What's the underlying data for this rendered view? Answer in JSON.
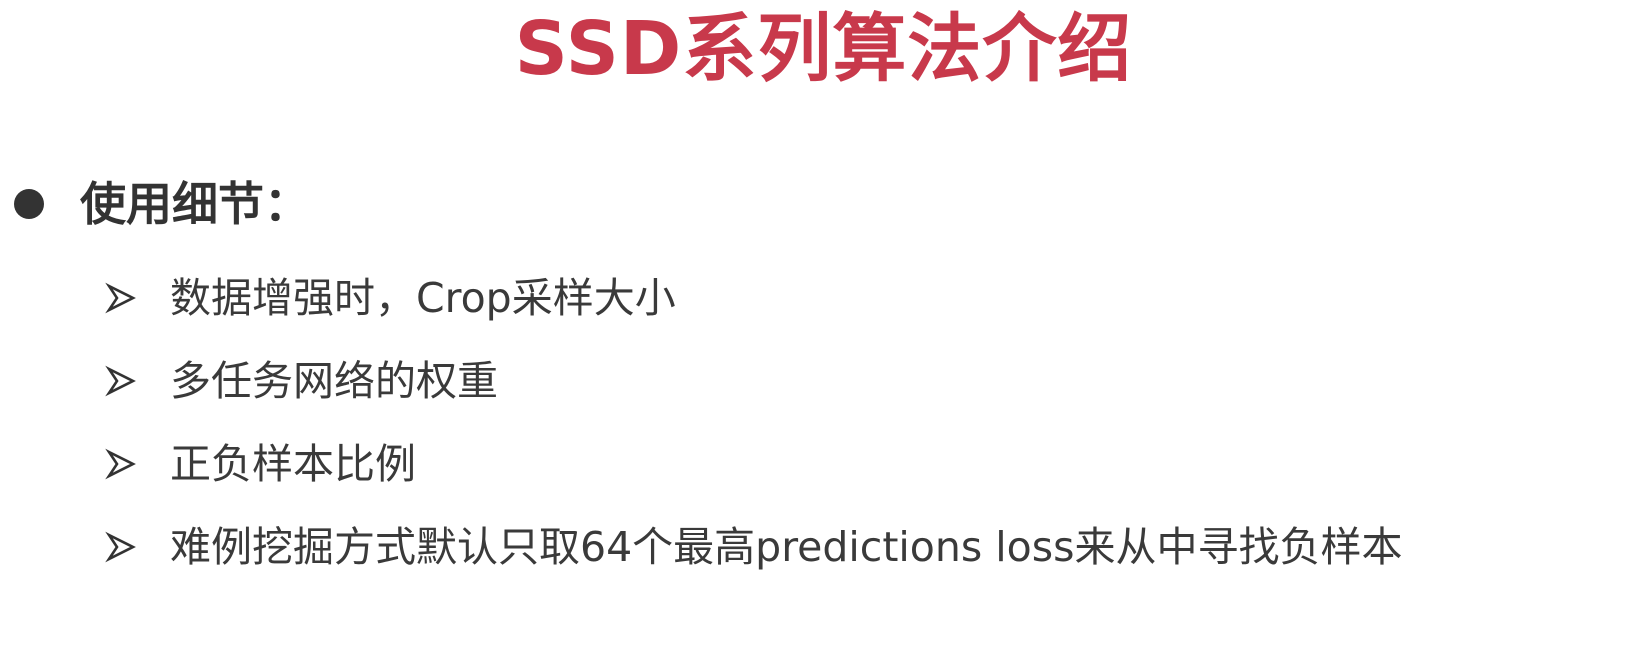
{
  "slide": {
    "title": "SSD系列算法介绍",
    "section": {
      "bullet_icon": "filled-circle-bullet-icon",
      "label": "使用细节："
    },
    "items": [
      {
        "icon": "arrow-bullet-icon",
        "text": "数据增强时，Crop采样大小"
      },
      {
        "icon": "arrow-bullet-icon",
        "text": "多任务网络的权重"
      },
      {
        "icon": "arrow-bullet-icon",
        "text": "正负样本比例"
      },
      {
        "icon": "arrow-bullet-icon",
        "text": "难例挖掘方式默认只取64个最高predictions loss来从中寻找负样本"
      }
    ]
  },
  "colors": {
    "title": "#c8394b",
    "body_text": "#3a3a3a",
    "bullet": "#333333",
    "background": "#ffffff"
  }
}
